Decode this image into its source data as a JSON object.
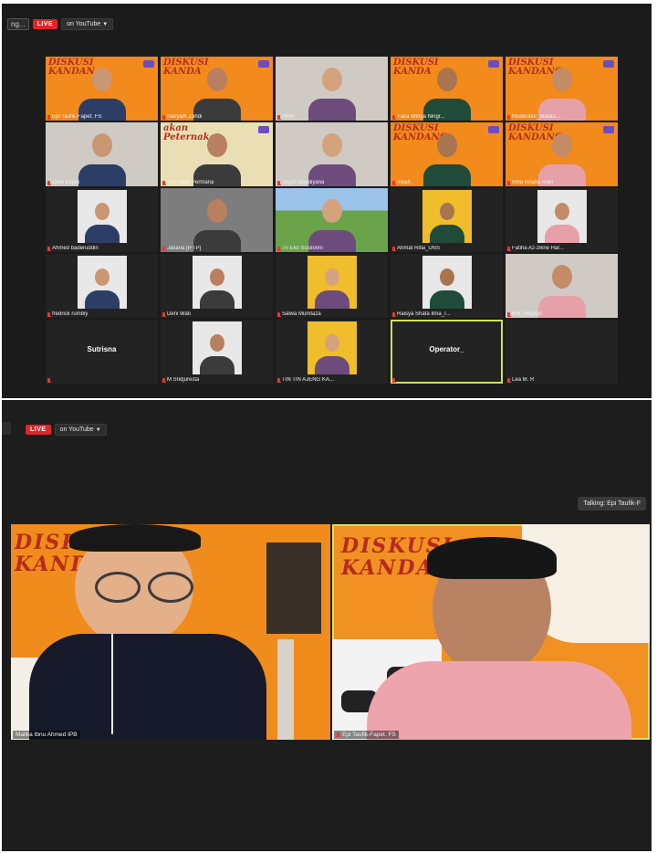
{
  "top_meeting": {
    "stream": {
      "meeting_chip": "ng...",
      "live_badge": "LIVE",
      "youtube_label": "on YouTube"
    },
    "participants": [
      {
        "name": "Epi Taufik-Fapet. FS",
        "bg": "org",
        "banner": "DISKUSI KANDAN"
      },
      {
        "name": "Maryam Zahdi",
        "bg": "org",
        "banner": "DISKUSI KANDA"
      },
      {
        "name": "Arifin",
        "bg": "lt"
      },
      {
        "name": "Tiara Widya Ningr...",
        "bg": "org",
        "banner": "DISKUSI KANDA"
      },
      {
        "name": "Moderator_Malika ...",
        "bg": "org",
        "banner": "DISKUSI KANDANG"
      },
      {
        "name": "Cilila Etipro",
        "bg": "lt"
      },
      {
        "name": "Idal Galih Permana",
        "bg": "cream",
        "banner": "akan Peternakan"
      },
      {
        "name": "Teguh Boediyana",
        "bg": "lt"
      },
      {
        "name": "Indah",
        "bg": "org",
        "banner": "DISKUSI KANDANG"
      },
      {
        "name": "Irma Isnafia Arief",
        "bg": "org",
        "banner": "DISKUSI KANDANG"
      },
      {
        "name": "Ahmed baderuddin",
        "bg": "dark",
        "inset": "white"
      },
      {
        "name": "Jakaria [IFTP]",
        "bg": "grey"
      },
      {
        "name": "Tri Eko Susilorini",
        "bg": "field"
      },
      {
        "name": "Ahmat Rifai_UNS",
        "bg": "dark",
        "inset": "yellow"
      },
      {
        "name": "Fatiha Az-zikrie Har...",
        "bg": "dark",
        "inset": "white"
      },
      {
        "name": "fredrick rumbly",
        "bg": "dark",
        "inset": "white"
      },
      {
        "name": "Deni Wati",
        "bg": "dark",
        "inset": "white"
      },
      {
        "name": "Salwa Mumtaza",
        "bg": "dark",
        "inset": "yellow"
      },
      {
        "name": "Raisya Shafa Ilma_I...",
        "bg": "dark",
        "inset": "white"
      },
      {
        "name": "IPB_Miqdad",
        "bg": "lt"
      },
      {
        "name": "",
        "bg": "dark",
        "center_name": "Sutrisna"
      },
      {
        "name": "M Sridjuresta",
        "bg": "dark",
        "inset": "white"
      },
      {
        "name": "TIN TIN AJENG KA...",
        "bg": "dark",
        "inset": "yellow"
      },
      {
        "name": "",
        "bg": "dark",
        "center_name": "Operator_",
        "selected": true
      },
      {
        "name": "Lea M. R",
        "bg": "dark"
      }
    ]
  },
  "bottom_meeting": {
    "stream": {
      "live_badge": "LIVE",
      "youtube_label": "on YouTube"
    },
    "talking_indicator": "Talking: Epi Taufik-F",
    "speaker_left": {
      "name": "Malika Ibnu Ahmed IPB",
      "banner": "DISKUSI KANDA"
    },
    "speaker_right": {
      "name": "Epi Taufik-Fapet. FS",
      "banner": "DISKUSI KANDA"
    }
  },
  "colors": {
    "live": "#e0262b",
    "active_outline": "#cfe05a",
    "banner_orange": "#f28a1c"
  }
}
